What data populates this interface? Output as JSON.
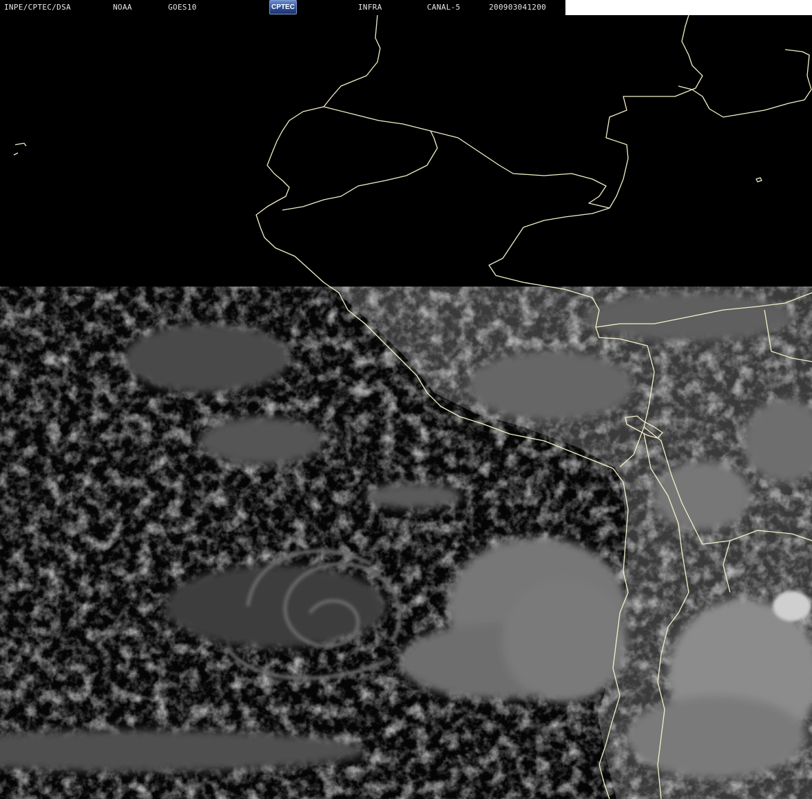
{
  "header": {
    "agency": "INPE/CPTEC/DSA",
    "noaa": "NOAA",
    "satellite": "GOES10",
    "logo_text": "CPTEC",
    "image_type": "INFRA",
    "channel": "CANAL-5",
    "timestamp": "200903041200"
  },
  "colors": {
    "background": "#000000",
    "coastline": "#f4f0c8",
    "cloud": "#8a8a8a",
    "cloud_bright": "#c8c8c8",
    "land": "#4a4a4a",
    "logo_blue": "#2c4e96",
    "header_text": "#e8e8e8"
  }
}
